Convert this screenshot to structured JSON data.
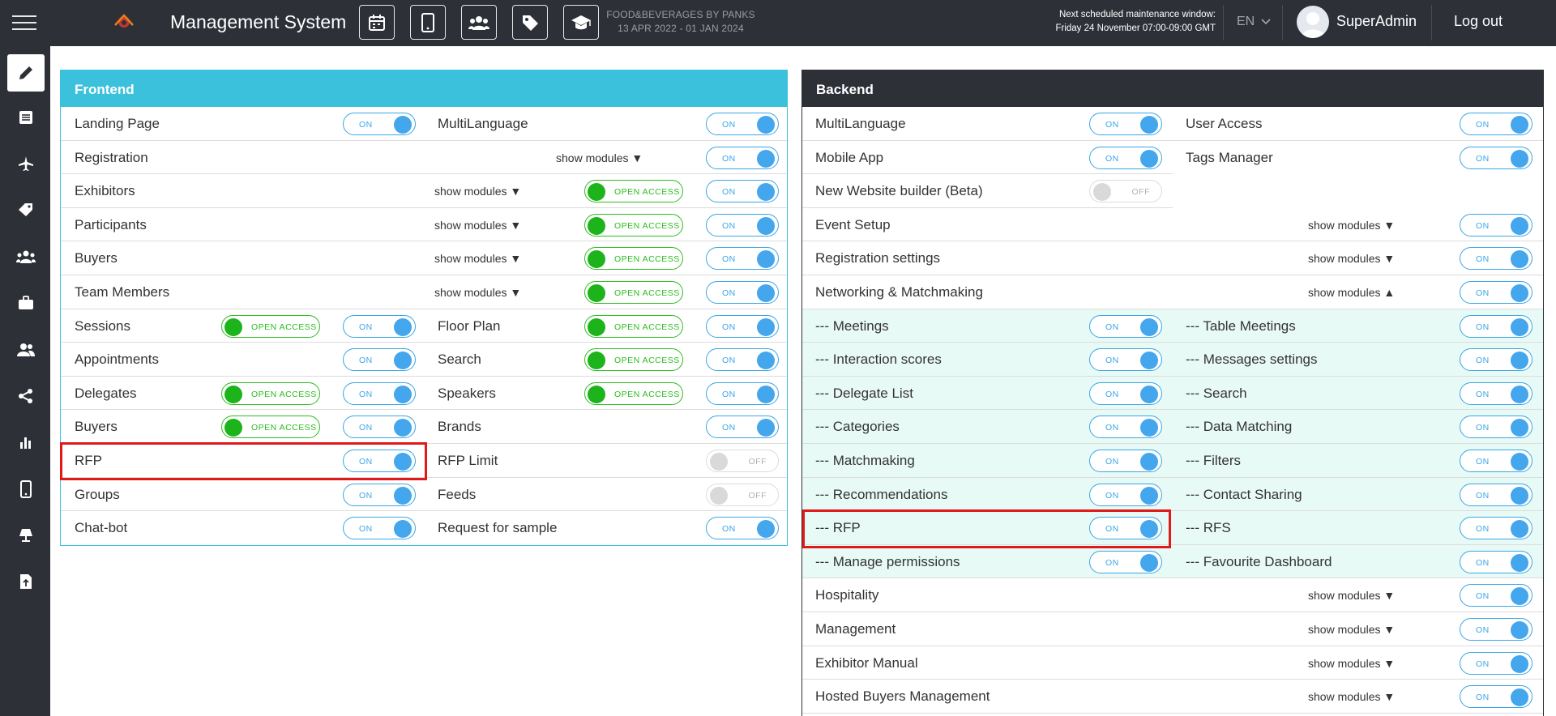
{
  "header": {
    "app_title": "Management System",
    "event_name": "FOOD&BEVERAGES BY PANKS",
    "event_dates": "13 APR 2022 - 01 JAN 2024",
    "maintenance_label": "Next scheduled maintenance window:",
    "maintenance_time": "Friday 24 November 07:00-09:00 GMT",
    "language": "EN",
    "user_name": "SuperAdmin",
    "logout_label": "Log out",
    "toolbar_icons": [
      "calendar-icon",
      "mobile-icon",
      "users-icon",
      "tag-icon",
      "graduation-cap-icon"
    ]
  },
  "sidebar": {
    "icons": [
      "pencil-icon",
      "list-icon",
      "plane-icon",
      "tags-icon",
      "group-icon",
      "briefcase-icon",
      "users-icon",
      "share-icon",
      "bar-chart-icon",
      "mobile-icon",
      "lamp-icon",
      "upload-file-icon"
    ],
    "active_index": 0
  },
  "labels": {
    "on": "ON",
    "off": "OFF",
    "open_access": "OPEN ACCESS",
    "show_modules_down": "show modules ▼",
    "show_modules_up": "show modules ▲"
  },
  "frontend": {
    "title": "Frontend",
    "rows": [
      {
        "left": "Landing Page",
        "right": "MultiLanguage"
      },
      {
        "left": "Registration"
      },
      {
        "left": "Exhibitors"
      },
      {
        "left": "Participants"
      },
      {
        "left": "Buyers"
      },
      {
        "left": "Team Members"
      },
      {
        "left": "Sessions",
        "right": "Floor Plan"
      },
      {
        "left": "Appointments",
        "right": "Search"
      },
      {
        "left": "Delegates",
        "right": "Speakers"
      },
      {
        "left": "Buyers",
        "right": "Brands"
      },
      {
        "left": "RFP",
        "right": "RFP Limit"
      },
      {
        "left": "Groups",
        "right": "Feeds"
      },
      {
        "left": "Chat-bot",
        "right": "Request for sample"
      }
    ]
  },
  "backend": {
    "title": "Backend",
    "rows": [
      {
        "left": "MultiLanguage",
        "right": "User Access"
      },
      {
        "left": "Mobile App",
        "right": "Tags Manager"
      },
      {
        "left": "New Website builder (Beta)"
      },
      {
        "left": "Event Setup"
      },
      {
        "left": "Registration settings"
      },
      {
        "left": "Networking & Matchmaking"
      },
      {
        "left": "--- Meetings",
        "right": "--- Table Meetings"
      },
      {
        "left": "--- Interaction scores",
        "right": "--- Messages settings"
      },
      {
        "left": "--- Delegate List",
        "right": "--- Search"
      },
      {
        "left": "--- Categories",
        "right": "--- Data Matching"
      },
      {
        "left": "--- Matchmaking",
        "right": "--- Filters"
      },
      {
        "left": "--- Recommendations",
        "right": "--- Contact Sharing"
      },
      {
        "left": "--- RFP",
        "right": "--- RFS"
      },
      {
        "left": "--- Manage permissions",
        "right": "--- Favourite Dashboard"
      },
      {
        "left": "Hospitality"
      },
      {
        "left": "Management"
      },
      {
        "left": "Exhibitor Manual"
      },
      {
        "left": "Hosted Buyers Management"
      }
    ]
  }
}
